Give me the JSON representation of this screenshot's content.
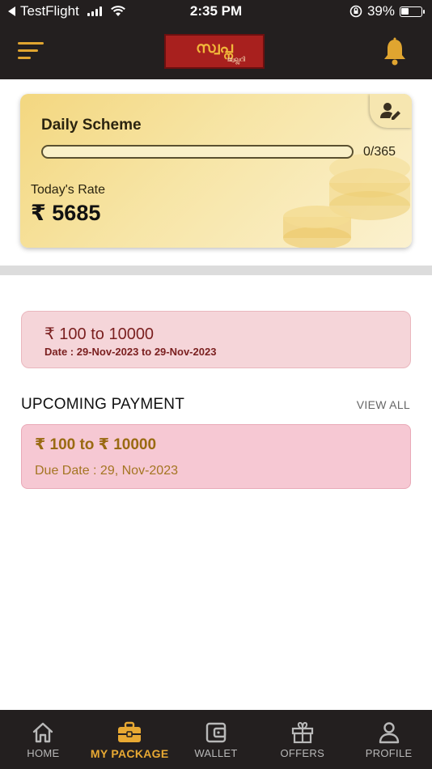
{
  "status_bar": {
    "back_app": "TestFlight",
    "time": "2:35 PM",
    "battery": "39%",
    "battery_level": 0.39
  },
  "header": {
    "logo_main": "സ്വപ്ന",
    "logo_sub": "ജ്വല്ലറി",
    "colors": {
      "bar": "#231f1f",
      "accent": "#e0a530"
    }
  },
  "scheme_card": {
    "title": "Daily Scheme",
    "progress_text": "0/365",
    "progress_fraction": 0,
    "rate_label": "Today's Rate",
    "rate_value": "₹ 5685"
  },
  "plan": {
    "range": "₹ 100 to 10000",
    "date": "Date : 29-Nov-2023  to  29-Nov-2023"
  },
  "upcoming": {
    "heading": "UPCOMING PAYMENT",
    "view_all": "VIEW ALL",
    "range": "₹ 100 to ₹ 10000",
    "due": "Due Date  : 29, Nov-2023"
  },
  "nav": {
    "items": [
      {
        "label": "HOME",
        "icon": "home-icon"
      },
      {
        "label": "MY PACKAGE",
        "icon": "briefcase-icon",
        "active": true
      },
      {
        "label": "WALLET",
        "icon": "wallet-icon"
      },
      {
        "label": "OFFERS",
        "icon": "gift-icon"
      },
      {
        "label": "PROFILE",
        "icon": "profile-icon"
      }
    ]
  }
}
